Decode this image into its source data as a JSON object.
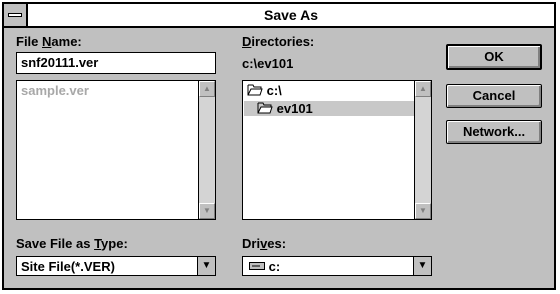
{
  "window": {
    "title": "Save As"
  },
  "file_name": {
    "label_pre": "File ",
    "label_key": "N",
    "label_post": "ame:",
    "value": "snf20111.ver",
    "list": [
      "sample.ver"
    ]
  },
  "directories": {
    "label_pre": "",
    "label_key": "D",
    "label_post": "irectories:",
    "current_path": "c:\\ev101",
    "items": [
      {
        "label": "c:\\",
        "icon": "open-folder-icon"
      },
      {
        "label": "ev101",
        "icon": "open-folder-icon"
      }
    ]
  },
  "save_type": {
    "label_pre": "Save File as ",
    "label_key": "T",
    "label_post": "ype:",
    "value": "Site File(*.VER)"
  },
  "drives": {
    "label_pre": "Dri",
    "label_key": "v",
    "label_post": "es:",
    "value": "c:",
    "icon": "drive-icon"
  },
  "buttons": {
    "ok": "OK",
    "cancel": "Cancel",
    "network": "Network..."
  },
  "scroll": {
    "up": "▲",
    "down": "▼",
    "dropdown": "▼"
  }
}
